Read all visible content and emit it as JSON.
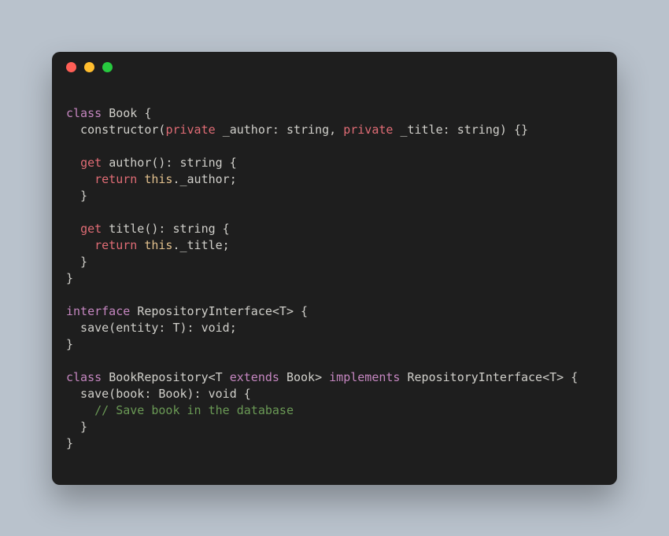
{
  "traffic_lights": {
    "red": "close",
    "yellow": "minimize",
    "green": "maximize"
  },
  "code": {
    "tokens": [
      [
        {
          "t": "class ",
          "c": "kw-decl"
        },
        {
          "t": "Book {",
          "c": "default"
        }
      ],
      [
        {
          "t": "  constructor(",
          "c": "default"
        },
        {
          "t": "private ",
          "c": "kw-mod"
        },
        {
          "t": "_author: string, ",
          "c": "default"
        },
        {
          "t": "private ",
          "c": "kw-mod"
        },
        {
          "t": "_title: string) {}",
          "c": "default"
        }
      ],
      [],
      [
        {
          "t": "  ",
          "c": "default"
        },
        {
          "t": "get ",
          "c": "kw-mod"
        },
        {
          "t": "author(): string {",
          "c": "default"
        }
      ],
      [
        {
          "t": "    ",
          "c": "default"
        },
        {
          "t": "return ",
          "c": "kw-ctrl"
        },
        {
          "t": "this",
          "c": "kw-this"
        },
        {
          "t": "._author;",
          "c": "default"
        }
      ],
      [
        {
          "t": "  }",
          "c": "default"
        }
      ],
      [],
      [
        {
          "t": "  ",
          "c": "default"
        },
        {
          "t": "get ",
          "c": "kw-mod"
        },
        {
          "t": "title(): string {",
          "c": "default"
        }
      ],
      [
        {
          "t": "    ",
          "c": "default"
        },
        {
          "t": "return ",
          "c": "kw-ctrl"
        },
        {
          "t": "this",
          "c": "kw-this"
        },
        {
          "t": "._title;",
          "c": "default"
        }
      ],
      [
        {
          "t": "  }",
          "c": "default"
        }
      ],
      [
        {
          "t": "}",
          "c": "default"
        }
      ],
      [],
      [
        {
          "t": "interface ",
          "c": "kw-decl"
        },
        {
          "t": "RepositoryInterface<T> {",
          "c": "default"
        }
      ],
      [
        {
          "t": "  save(entity: T): void;",
          "c": "default"
        }
      ],
      [
        {
          "t": "}",
          "c": "default"
        }
      ],
      [],
      [
        {
          "t": "class ",
          "c": "kw-decl"
        },
        {
          "t": "BookRepository<T ",
          "c": "default"
        },
        {
          "t": "extends ",
          "c": "kw-decl"
        },
        {
          "t": "Book> ",
          "c": "default"
        },
        {
          "t": "implements ",
          "c": "kw-decl"
        },
        {
          "t": "RepositoryInterface<T> {",
          "c": "default"
        }
      ],
      [
        {
          "t": "  save(book: Book): void {",
          "c": "default"
        }
      ],
      [
        {
          "t": "    ",
          "c": "default"
        },
        {
          "t": "// Save book in the database",
          "c": "comment"
        }
      ],
      [
        {
          "t": "  }",
          "c": "default"
        }
      ],
      [
        {
          "t": "}",
          "c": "default"
        }
      ]
    ]
  }
}
